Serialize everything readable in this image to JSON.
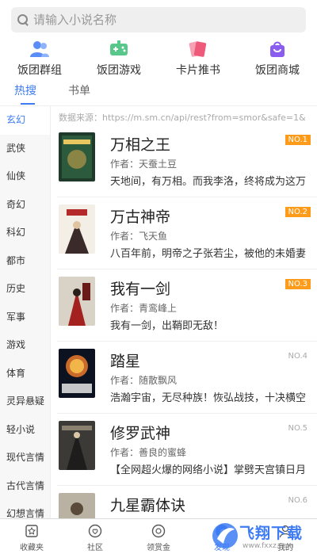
{
  "search": {
    "placeholder": "请输入小说名称"
  },
  "quicknav": [
    {
      "label": "饭团群组",
      "icon": "group-icon"
    },
    {
      "label": "饭团游戏",
      "icon": "game-icon"
    },
    {
      "label": "卡片推书",
      "icon": "cards-icon"
    },
    {
      "label": "饭团商城",
      "icon": "shop-bag-icon"
    }
  ],
  "tabs": {
    "hot": "热搜",
    "booklist": "书单"
  },
  "categories": [
    "玄幻",
    "武侠",
    "仙侠",
    "奇幻",
    "科幻",
    "都市",
    "历史",
    "军事",
    "游戏",
    "体育",
    "灵异悬疑",
    "轻小说",
    "现代言情",
    "古代言情",
    "幻想言情"
  ],
  "source": "数据来源：https://m.sm.cn/api/rest?from=smor&safe=1&",
  "books": [
    {
      "rank": "NO.1",
      "title": "万相之王",
      "author": "作者：天蚕土豆",
      "desc": "天地间，有万相。而我李洛，终将成为这万"
    },
    {
      "rank": "NO.2",
      "title": "万古神帝",
      "author": "作者：飞天鱼",
      "desc": "八百年前，明帝之子张若尘，被他的未婚妻"
    },
    {
      "rank": "NO.3",
      "title": "我有一剑",
      "author": "作者：青鸾峰上",
      "desc": "我有一剑，出鞘即无敌！"
    },
    {
      "rank": "NO.4",
      "title": "踏星",
      "author": "作者：随散飘风",
      "desc": "浩瀚宇宙，无尽种族！恢弘战技，十决横空"
    },
    {
      "rank": "NO.5",
      "title": "修罗武神",
      "author": "作者：善良的蜜蜂",
      "desc": "【全网超火爆的网络小说】掌劈天宫镇日月"
    },
    {
      "rank": "NO.6",
      "title": "九星霸体诀",
      "author": "",
      "desc": ""
    }
  ],
  "bottombar": [
    {
      "label": "收藏夹",
      "icon": "bookshelf-icon"
    },
    {
      "label": "社区",
      "icon": "chat-heart-icon"
    },
    {
      "label": "领赏金",
      "icon": "coin-icon"
    },
    {
      "label": "发现",
      "icon": "discover-icon"
    },
    {
      "label": "我的",
      "icon": "profile-icon"
    }
  ],
  "watermark": {
    "text": "飞翔下载",
    "url": "www.fxxz.com"
  },
  "colors": {
    "accent": "#3d7bf4",
    "rank_top": "#ff9b1a"
  }
}
